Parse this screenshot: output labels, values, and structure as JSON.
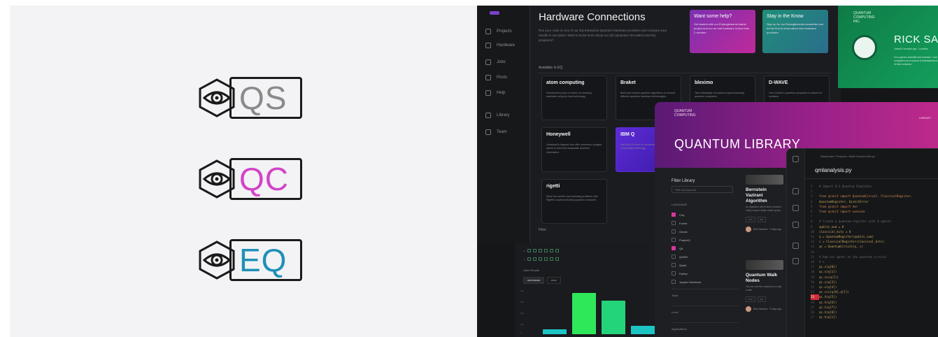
{
  "logos": [
    {
      "text": "QS",
      "color": "#8a8a8a"
    },
    {
      "text": "QC",
      "color": "#d245c8"
    },
    {
      "text": "EQ",
      "color": "#1f90b8"
    }
  ],
  "hardware": {
    "title": "Hardware Connections",
    "intro": "Run your code on any of our EQ Enterprise Quantum hardware providers and compare your results in one place. Want to know more about our QS (Quantum Simulator) and EQ programs?",
    "available_label": "Available in EQ",
    "filter_label": "Filter",
    "sidebar": [
      "Projects",
      "Hardware",
      "Jobs",
      "Posts",
      "Help",
      "Library",
      "Team"
    ],
    "promos": [
      {
        "heading": "Want some help?",
        "body": "Get started with our Entanglements starter project and run on real hardware in less than 2 minutes."
      },
      {
        "heading": "Stay in the Know",
        "body": "Sign up for our Entanglements newsletter and be the first to know about new hardware providers."
      }
    ],
    "providers": [
      {
        "name": "atom computing",
        "desc": "Harness the power of atoms on amazing hardware using ion trap technology."
      },
      {
        "name": "Braket",
        "desc": "Build and explore quantum algorithms on several different quantum hardware technologies."
      },
      {
        "name": "bleximo",
        "desc": "Take advantage of practical superconducting quantum computers."
      },
      {
        "name": "D-WAVE",
        "desc": "Use D-Wave's quantum computers to search for solutions."
      },
      {
        "name": "Honeywell",
        "desc": "Honeywell's trapped ions offer numerous charged atoms to hold and manipulate quantum information."
      },
      {
        "name": "IBM Q",
        "desc": "Use IBM Q's fleet of commercial devices conducting technology."
      },
      {
        "name": "rigetti",
        "desc": "Solve the world's most pressing problems with Rigetti's superconducting quantum computer."
      }
    ]
  },
  "profile": {
    "brand": "QUANTUM COMPUTING INC.",
    "name": "RICK SANCHEZ",
    "subtitle": "Joined 5 months ago · Location",
    "bio": "I'm a genius scientist and inventor. I use quantum computers as a source of entertainment and for the safety of their universe."
  },
  "library": {
    "brand": "QUANTUM COMPUTING",
    "menu": "LIBRARY",
    "title": "QUANTUM LIBRARY",
    "filter_title": "Filter Library",
    "search_placeholder": "Filter by keyword",
    "language_label": "LANGUAGE",
    "languages": [
      {
        "label": "Cirq",
        "checked": true
      },
      {
        "label": "Forest",
        "checked": false
      },
      {
        "label": "Ocean",
        "checked": false
      },
      {
        "label": "ProjectQ",
        "checked": false
      },
      {
        "label": "Q#",
        "checked": true
      },
      {
        "label": "QASM",
        "checked": false
      },
      {
        "label": "Qiskit",
        "checked": false
      },
      {
        "label": "Python",
        "checked": false
      },
      {
        "label": "Jupyter Notebook",
        "checked": false
      }
    ],
    "groups": [
      "Tools",
      "Level",
      "Applications"
    ],
    "cards": [
      {
        "title": "Bernstein Vazirani Algorithm",
        "desc": "An algorithm which finds a hidden string using a single oracle query.",
        "tags": [
          "Cirq",
          "Q#"
        ],
        "author": "Rick Sanchez · 3 days ago"
      },
      {
        "title": "Quantum Walk Nodes",
        "desc": "You can use this notebook to walk nodes.",
        "tags": [
          "Cirq",
          "Q#"
        ],
        "author": "Rick Sanchez · 5 days ago"
      }
    ]
  },
  "editor": {
    "breadcrumb": "Dashboard  /  Projects  /  Multi-Function Bit.syl",
    "filename": "qmlanalysis.py",
    "lines": [
      {
        "n": "1",
        "text": "# import Q.S.Quantum Simulator",
        "kind": "c"
      },
      {
        "n": "2",
        "text": "",
        "kind": ""
      },
      {
        "n": "3",
        "text": "from qiskit import QuantumCircuit, ClassicalRegister,",
        "kind": "k"
      },
      {
        "n": "4",
        "text": "QuantumRegister, QiskitError",
        "kind": ""
      },
      {
        "n": "5",
        "text": "from qiskit import Aer",
        "kind": "k"
      },
      {
        "n": "6",
        "text": "from qiskit import execute",
        "kind": "k"
      },
      {
        "n": "7",
        "text": "",
        "kind": ""
      },
      {
        "n": "8",
        "text": "# Create a quantum register with 8 qubits",
        "kind": "c"
      },
      {
        "n": "9",
        "text": "qubits_num = 8",
        "kind": ""
      },
      {
        "n": "10",
        "text": "classical_bits = 8",
        "kind": ""
      },
      {
        "n": "11",
        "text": "q = QuantumRegister(qubits_num)",
        "kind": ""
      },
      {
        "n": "12",
        "text": "c = ClassicalRegister(classical_bits)",
        "kind": ""
      },
      {
        "n": "13",
        "text": "qc = QuantumCircuit(q, c)",
        "kind": ""
      },
      {
        "n": "14",
        "text": "",
        "kind": ""
      },
      {
        "n": "15",
        "text": "# Add our gates to the quantum circuit",
        "kind": "c"
      },
      {
        "n": "16",
        "text": "# x",
        "kind": "c"
      },
      {
        "n": "17",
        "text": "qc.x(q[0])",
        "kind": ""
      },
      {
        "n": "18",
        "text": "qc.x(q[1])",
        "kind": ""
      },
      {
        "n": "19",
        "text": "qc.cx(q[2])",
        "kind": ""
      },
      {
        "n": "20",
        "text": "qc.x(q[3])",
        "kind": ""
      },
      {
        "n": "21",
        "text": "qc.x(q[4])",
        "kind": ""
      },
      {
        "n": "22",
        "text": "qc.ccx(q[0],q[1])",
        "kind": ""
      },
      {
        "n": "23",
        "text": "qc.h(q[5])",
        "kind": "",
        "hot": true
      },
      {
        "n": "24",
        "text": "qc.h(q[6])",
        "kind": ""
      },
      {
        "n": "25",
        "text": "qc.h(q[7])",
        "kind": ""
      },
      {
        "n": "26",
        "text": "qc.h(q[0])",
        "kind": ""
      },
      {
        "n": "27",
        "text": "qc.h(q[1])",
        "kind": ""
      }
    ]
  },
  "results": {
    "label": "Gate Results",
    "tabs": [
      "HISTOGRAM",
      "DATA"
    ],
    "yticks": [
      "400",
      "300",
      "200",
      "100",
      "0"
    ],
    "bars": [
      {
        "value": 0.12,
        "color": "#1cc4c4"
      },
      {
        "value": 0.95,
        "color": "#2ee85a"
      },
      {
        "value": 0.78,
        "color": "#24d47a"
      },
      {
        "value": 0.2,
        "color": "#1cc4c4"
      }
    ]
  }
}
